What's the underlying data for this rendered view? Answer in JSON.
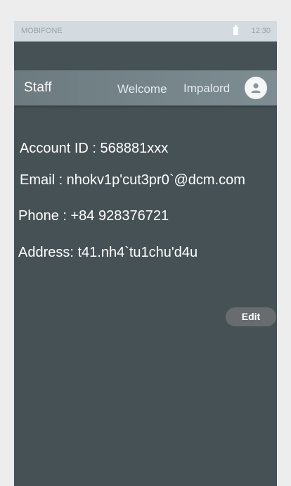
{
  "status_bar": {
    "carrier": "MOBIFONE",
    "time": "12:30"
  },
  "app_bar": {
    "title": "Staff",
    "welcome_label": "Welcome",
    "username": "Impalord",
    "avatar_icon": "person-icon"
  },
  "profile": {
    "account_id": "Account ID : 568881xxx",
    "email": "Email : nhokv1p'cut3pr0`@dcm.com",
    "phone": "Phone : +84 928376721",
    "address": "Address: t41.nh4`tu1chu'd4u"
  },
  "actions": {
    "edit_label": "Edit"
  },
  "colors": {
    "background": "#465155",
    "app_bar": "#75858a",
    "status_bar": "#d3dbe0",
    "edit_button": "#686c6e"
  }
}
